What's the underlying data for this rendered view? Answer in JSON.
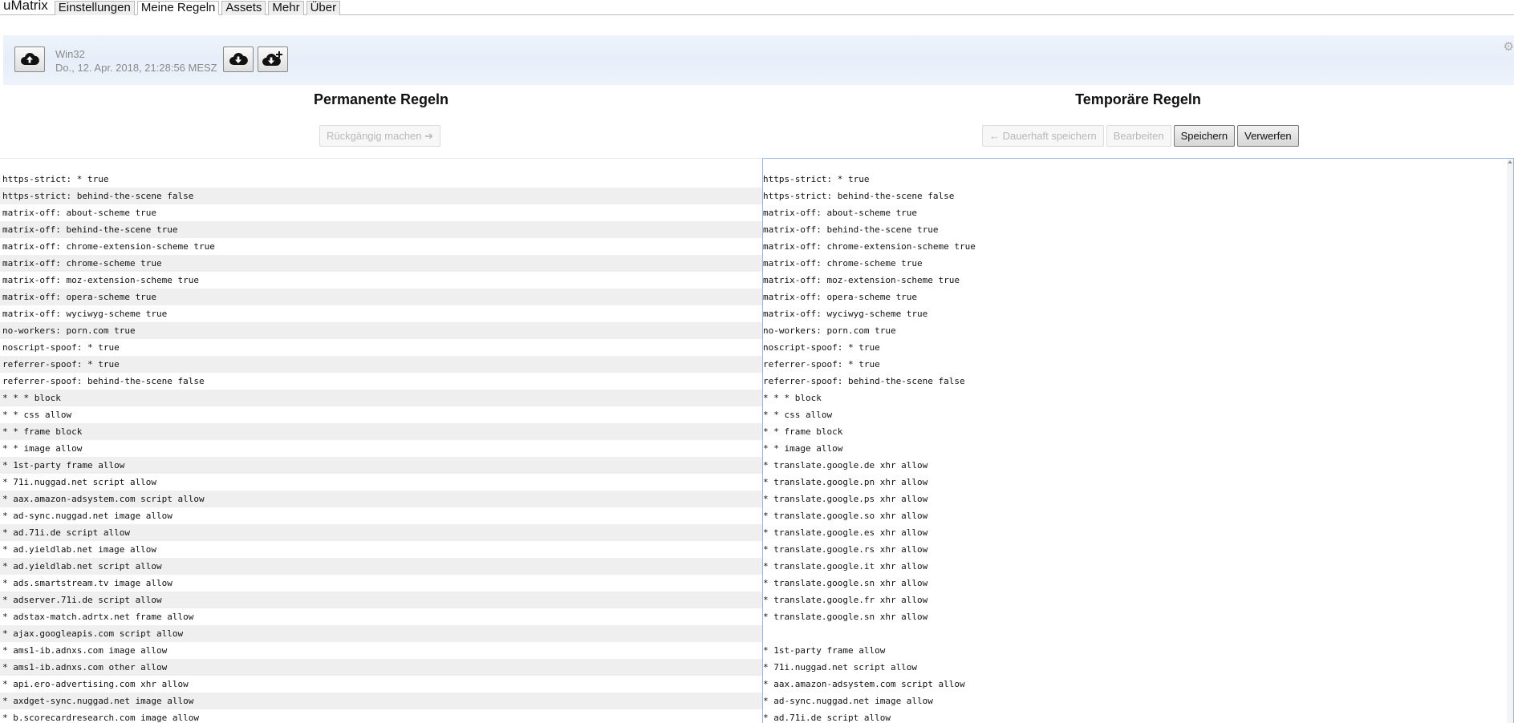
{
  "app": {
    "title": "uMatrix",
    "tabs": [
      {
        "label": "Einstellungen",
        "active": false
      },
      {
        "label": "Meine Regeln",
        "active": true
      },
      {
        "label": "Assets",
        "active": false
      },
      {
        "label": "Mehr",
        "active": false
      },
      {
        "label": "Über",
        "active": false
      }
    ]
  },
  "backup": {
    "platform": "Win32",
    "timestamp": "Do., 12. Apr. 2018, 21:28:56 MESZ",
    "icons": [
      "cloud-upload-icon",
      "cloud-download-icon",
      "cloud-download-plus-icon",
      "gear-icon"
    ]
  },
  "permanent": {
    "heading": "Permanente Regeln",
    "undo_label": "Rückgängig machen ➔",
    "rules": [
      "https-strict: * true",
      "https-strict: behind-the-scene false",
      "matrix-off: about-scheme true",
      "matrix-off: behind-the-scene true",
      "matrix-off: chrome-extension-scheme true",
      "matrix-off: chrome-scheme true",
      "matrix-off: moz-extension-scheme true",
      "matrix-off: opera-scheme true",
      "matrix-off: wyciwyg-scheme true",
      "no-workers: porn.com true",
      "noscript-spoof: * true",
      "referrer-spoof: * true",
      "referrer-spoof: behind-the-scene false",
      "* * * block",
      "* * css allow",
      "* * frame block",
      "* * image allow",
      "* 1st-party frame allow",
      "* 71i.nuggad.net script allow",
      "* aax.amazon-adsystem.com script allow",
      "* ad-sync.nuggad.net image allow",
      "* ad.71i.de script allow",
      "* ad.yieldlab.net image allow",
      "* ad.yieldlab.net script allow",
      "* ads.smartstream.tv image allow",
      "* adserver.71i.de script allow",
      "* adstax-match.adrtx.net frame allow",
      "* ajax.googleapis.com script allow",
      "* ams1-ib.adnxs.com image allow",
      "* ams1-ib.adnxs.com other allow",
      "* api.ero-advertising.com xhr allow",
      "* axdget-sync.nuggad.net image allow",
      "* b.scorecardresearch.com image allow"
    ]
  },
  "temporary": {
    "heading": "Temporäre Regeln",
    "persist_label": "← Dauerhaft speichern",
    "edit_label": "Bearbeiten",
    "save_label": "Speichern",
    "discard_label": "Verwerfen",
    "rules": [
      "https-strict: * true",
      "https-strict: behind-the-scene false",
      "matrix-off: about-scheme true",
      "matrix-off: behind-the-scene true",
      "matrix-off: chrome-extension-scheme true",
      "matrix-off: chrome-scheme true",
      "matrix-off: moz-extension-scheme true",
      "matrix-off: opera-scheme true",
      "matrix-off: wyciwyg-scheme true",
      "no-workers: porn.com true",
      "noscript-spoof: * true",
      "referrer-spoof: * true",
      "referrer-spoof: behind-the-scene false",
      "* * * block",
      "* * css allow",
      "* * frame block",
      "* * image allow",
      "* translate.google.de xhr allow",
      "* translate.google.pn xhr allow",
      "* translate.google.ps xhr allow",
      "* translate.google.so xhr allow",
      "* translate.google.es xhr allow",
      "* translate.google.rs xhr allow",
      "* translate.google.it xhr allow",
      "* translate.google.sn xhr allow",
      "* translate.google.fr xhr allow",
      "* translate.google.sn xhr allow",
      "",
      "* 1st-party frame allow",
      "* 71i.nuggad.net script allow",
      "* aax.amazon-adsystem.com script allow",
      "* ad-sync.nuggad.net image allow",
      "* ad.71i.de script allow"
    ]
  }
}
